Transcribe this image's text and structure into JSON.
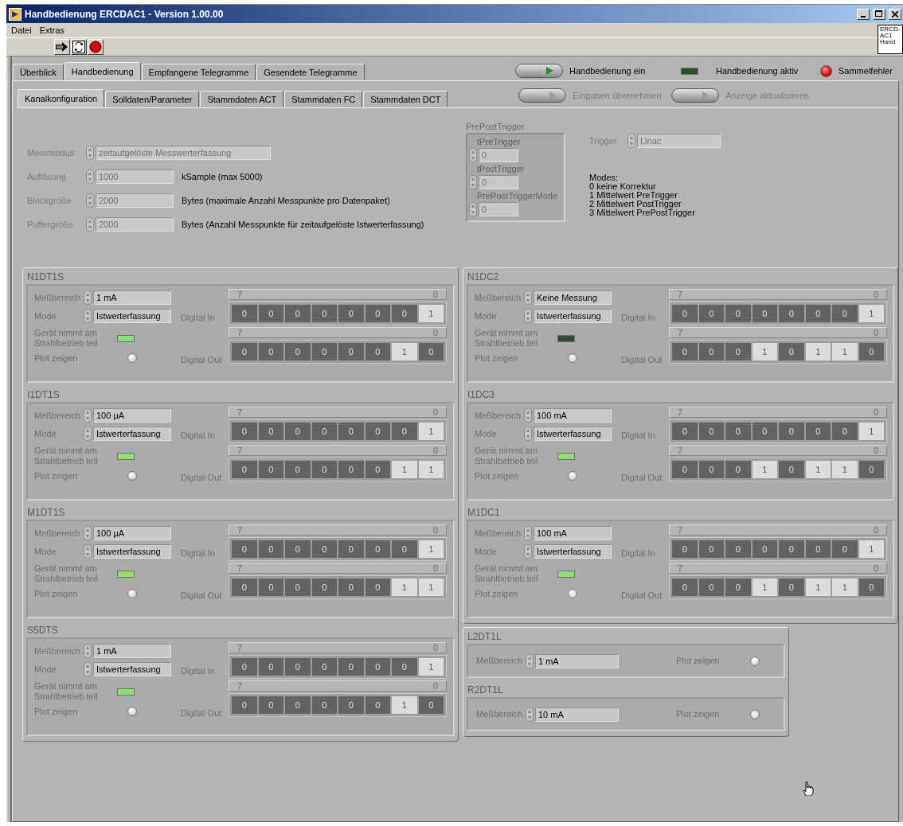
{
  "window": {
    "title": "Handbedienung ERCDAC1 - Version 1.00.00"
  },
  "menu": [
    "Datei",
    "Extras"
  ],
  "side_badge": [
    "ERCD-",
    "AC1",
    "Hand"
  ],
  "tabs": [
    {
      "label": "Überblick",
      "selected": false
    },
    {
      "label": "Handbedienung",
      "selected": true
    },
    {
      "label": "Empfangene Telegramme",
      "selected": false
    },
    {
      "label": "Gesendete Telegramme",
      "selected": false
    }
  ],
  "header_controls": [
    {
      "kind": "toggle",
      "label": "Handbedienung ein",
      "disabled": false
    },
    {
      "kind": "led",
      "label": "Handbedienung aktiv",
      "on": false
    },
    {
      "kind": "lamp",
      "label": "Sammelfehler",
      "on": true
    }
  ],
  "subtabs": [
    {
      "label": "Kanalkonfiguration",
      "selected": true
    },
    {
      "label": "Solldaten/Parameter",
      "selected": false
    },
    {
      "label": "Stammdaten ACT",
      "selected": false
    },
    {
      "label": "Stammdaten FC",
      "selected": false
    },
    {
      "label": "Stammdaten DCT",
      "selected": false
    }
  ],
  "subtab_controls": [
    {
      "label": "Eingaben übernehmen",
      "disabled": true
    },
    {
      "label": "Anzeige aktualisieren",
      "disabled": true
    }
  ],
  "config": {
    "fields": [
      {
        "label": "Messmodus",
        "value": "zeitaufgelöste Messwerterfassung",
        "disabled": true,
        "kind": "wide"
      },
      {
        "label": "Auflösung",
        "value": "1000",
        "unit": "kSample (max 5000)",
        "disabled": true,
        "kind": "narrow"
      },
      {
        "label": "Blockgröße",
        "value": "2000",
        "unit": "Bytes  (maximale Anzahl Messpunkte  pro Datenpaket)",
        "disabled": true,
        "kind": "narrow"
      },
      {
        "label": "Puffergröße",
        "value": "2000",
        "unit": "Bytes (Anzahl Messpunkte für zeitaufgelöste Istwerterfassung)",
        "disabled": true,
        "kind": "narrow"
      }
    ],
    "prepost": {
      "title": "PrePostTrigger",
      "fields": [
        {
          "label": "tPreTrigger",
          "value": "0",
          "disabled": true
        },
        {
          "label": "tPostTrigger",
          "value": "0",
          "disabled": true
        },
        {
          "label": "PrePostTriggerMode",
          "value": "0",
          "disabled": true
        }
      ]
    },
    "trigger": {
      "label": "Trigger",
      "value": "Linac",
      "disabled": true
    },
    "modes": [
      "Modes:",
      "0 keine Korrektur",
      "1 Mittelwert PreTrigger",
      "2 Mittelwert PostTrigger",
      "3 Mittelwert PrePostTrigger"
    ]
  },
  "left_channels": [
    {
      "name": "N1DT1S",
      "range_label": "Meßbereich",
      "range": "1 mA",
      "mode_label": "Mode",
      "mode": "Istwerterfassung",
      "led_label": "Gerät nimmt am Strahlbetrieb teil",
      "led_on": true,
      "plot_label": "Plot zeigen",
      "plot_on": false,
      "digital_in": {
        "label": "Digital In",
        "high": "7",
        "low": "0",
        "bits": [
          {
            "text": "0",
            "on": false
          },
          {
            "text": "0",
            "on": false
          },
          {
            "text": "0",
            "on": false
          },
          {
            "text": "0",
            "on": false
          },
          {
            "text": "0",
            "on": false
          },
          {
            "text": "0",
            "on": false
          },
          {
            "text": "0",
            "on": false
          },
          {
            "text": "1",
            "on": true
          }
        ]
      },
      "digital_out": {
        "label": "Digital Out",
        "high": "7",
        "low": "0",
        "bits": [
          {
            "text": "0",
            "on": false
          },
          {
            "text": "0",
            "on": false
          },
          {
            "text": "0",
            "on": false
          },
          {
            "text": "0",
            "on": false
          },
          {
            "text": "0",
            "on": false
          },
          {
            "text": "0",
            "on": false
          },
          {
            "text": "1",
            "on": true
          },
          {
            "text": "0",
            "on": false
          }
        ]
      }
    },
    {
      "name": "I1DT1S",
      "range_label": "Meßbereich",
      "range": "100 µA",
      "mode_label": "Mode",
      "mode": "Istwerterfassung",
      "led_label": "Gerät nimmt am Strahlbetrieb teil",
      "led_on": true,
      "plot_label": "Plot zeigen",
      "plot_on": false,
      "digital_in": {
        "label": "Digital In",
        "high": "7",
        "low": "0",
        "bits": [
          {
            "text": "0",
            "on": false
          },
          {
            "text": "0",
            "on": false
          },
          {
            "text": "0",
            "on": false
          },
          {
            "text": "0",
            "on": false
          },
          {
            "text": "0",
            "on": false
          },
          {
            "text": "0",
            "on": false
          },
          {
            "text": "0",
            "on": false
          },
          {
            "text": "1",
            "on": true
          }
        ]
      },
      "digital_out": {
        "label": "Digital Out",
        "high": "7",
        "low": "0",
        "bits": [
          {
            "text": "0",
            "on": false
          },
          {
            "text": "0",
            "on": false
          },
          {
            "text": "0",
            "on": false
          },
          {
            "text": "0",
            "on": false
          },
          {
            "text": "0",
            "on": false
          },
          {
            "text": "0",
            "on": false
          },
          {
            "text": "1",
            "on": true
          },
          {
            "text": "1",
            "on": true
          }
        ]
      }
    },
    {
      "name": "M1DT1S",
      "range_label": "Meßbereich",
      "range": "100 µA",
      "mode_label": "Mode",
      "mode": "Istwerterfassung",
      "led_label": "Gerät nimmt am Strahlbetrieb teil",
      "led_on": true,
      "plot_label": "Plot zeigen",
      "plot_on": false,
      "digital_in": {
        "label": "Digital In",
        "high": "7",
        "low": "0",
        "bits": [
          {
            "text": "0",
            "on": false
          },
          {
            "text": "0",
            "on": false
          },
          {
            "text": "0",
            "on": false
          },
          {
            "text": "0",
            "on": false
          },
          {
            "text": "0",
            "on": false
          },
          {
            "text": "0",
            "on": false
          },
          {
            "text": "0",
            "on": false
          },
          {
            "text": "1",
            "on": true
          }
        ]
      },
      "digital_out": {
        "label": "Digital Out",
        "high": "7",
        "low": "0",
        "bits": [
          {
            "text": "0",
            "on": false
          },
          {
            "text": "0",
            "on": false
          },
          {
            "text": "0",
            "on": false
          },
          {
            "text": "0",
            "on": false
          },
          {
            "text": "0",
            "on": false
          },
          {
            "text": "0",
            "on": false
          },
          {
            "text": "1",
            "on": true
          },
          {
            "text": "1",
            "on": true
          }
        ]
      }
    },
    {
      "name": "S5DTS",
      "range_label": "Meßbereich",
      "range": "1 mA",
      "mode_label": "Mode",
      "mode": "Istwerterfassung",
      "led_label": "Gerät nimmt am Strahlbetrieb teil",
      "led_on": true,
      "plot_label": "Plot zeigen",
      "plot_on": false,
      "digital_in": {
        "label": "Digital In",
        "high": "7",
        "low": "0",
        "bits": [
          {
            "text": "0",
            "on": false
          },
          {
            "text": "0",
            "on": false
          },
          {
            "text": "0",
            "on": false
          },
          {
            "text": "0",
            "on": false
          },
          {
            "text": "0",
            "on": false
          },
          {
            "text": "0",
            "on": false
          },
          {
            "text": "0",
            "on": false
          },
          {
            "text": "1",
            "on": true
          }
        ]
      },
      "digital_out": {
        "label": "Digital Out",
        "high": "7",
        "low": "0",
        "bits": [
          {
            "text": "0",
            "on": false
          },
          {
            "text": "0",
            "on": false
          },
          {
            "text": "0",
            "on": false
          },
          {
            "text": "0",
            "on": false
          },
          {
            "text": "0",
            "on": false
          },
          {
            "text": "0",
            "on": false
          },
          {
            "text": "1",
            "on": true
          },
          {
            "text": "0",
            "on": false
          }
        ]
      }
    }
  ],
  "right_channels": [
    {
      "name": "N1DC2",
      "range_label": "Meßbereich",
      "range": "Keine Messung",
      "mode_label": "Mode",
      "mode": "Istwerterfassung",
      "led_label": "Gerät nimmt am Strahlbetrieb teil",
      "led_on": false,
      "plot_label": "Plot zeigen",
      "plot_on": false,
      "digital_in": {
        "label": "Digital In",
        "high": "7",
        "low": "0",
        "bits": [
          {
            "text": "0",
            "on": false
          },
          {
            "text": "0",
            "on": false
          },
          {
            "text": "0",
            "on": false
          },
          {
            "text": "0",
            "on": false
          },
          {
            "text": "0",
            "on": false
          },
          {
            "text": "0",
            "on": false
          },
          {
            "text": "0",
            "on": false
          },
          {
            "text": "1",
            "on": true
          }
        ]
      },
      "digital_out": {
        "label": "Digital Out",
        "high": "7",
        "low": "0",
        "bits": [
          {
            "text": "0",
            "on": false
          },
          {
            "text": "0",
            "on": false
          },
          {
            "text": "0",
            "on": false
          },
          {
            "text": "1",
            "on": true
          },
          {
            "text": "0",
            "on": false
          },
          {
            "text": "1",
            "on": true
          },
          {
            "text": "1",
            "on": true
          },
          {
            "text": "0",
            "on": false
          }
        ]
      }
    },
    {
      "name": "I1DC3",
      "range_label": "Meßbereich",
      "range": "100 mA",
      "mode_label": "Mode",
      "mode": "Istwerterfassung",
      "led_label": "Gerät nimmt am Strahlbetrieb teil",
      "led_on": true,
      "plot_label": "Plot zeigen",
      "plot_on": false,
      "digital_in": {
        "label": "Digital In",
        "high": "7",
        "low": "0",
        "bits": [
          {
            "text": "0",
            "on": false
          },
          {
            "text": "0",
            "on": false
          },
          {
            "text": "0",
            "on": false
          },
          {
            "text": "0",
            "on": false
          },
          {
            "text": "0",
            "on": false
          },
          {
            "text": "0",
            "on": false
          },
          {
            "text": "0",
            "on": false
          },
          {
            "text": "1",
            "on": true
          }
        ]
      },
      "digital_out": {
        "label": "Digital Out",
        "high": "7",
        "low": "0",
        "bits": [
          {
            "text": "0",
            "on": false
          },
          {
            "text": "0",
            "on": false
          },
          {
            "text": "0",
            "on": false
          },
          {
            "text": "1",
            "on": true
          },
          {
            "text": "0",
            "on": false
          },
          {
            "text": "1",
            "on": true
          },
          {
            "text": "1",
            "on": true
          },
          {
            "text": "0",
            "on": false
          }
        ]
      }
    },
    {
      "name": "M1DC1",
      "range_label": "Meßbereich",
      "range": "100 mA",
      "mode_label": "Mode",
      "mode": "Istwerterfassung",
      "led_label": "Gerät nimmt am Strahlbetrieb teil",
      "led_on": true,
      "plot_label": "Plot zeigen",
      "plot_on": false,
      "digital_in": {
        "label": "Digital In",
        "high": "7",
        "low": "0",
        "bits": [
          {
            "text": "0",
            "on": false
          },
          {
            "text": "0",
            "on": false
          },
          {
            "text": "0",
            "on": false
          },
          {
            "text": "0",
            "on": false
          },
          {
            "text": "0",
            "on": false
          },
          {
            "text": "0",
            "on": false
          },
          {
            "text": "0",
            "on": false
          },
          {
            "text": "1",
            "on": true
          }
        ]
      },
      "digital_out": {
        "label": "Digital Out",
        "high": "7",
        "low": "0",
        "bits": [
          {
            "text": "0",
            "on": false
          },
          {
            "text": "0",
            "on": false
          },
          {
            "text": "0",
            "on": false
          },
          {
            "text": "1",
            "on": true
          },
          {
            "text": "0",
            "on": false
          },
          {
            "text": "1",
            "on": true
          },
          {
            "text": "1",
            "on": true
          },
          {
            "text": "0",
            "on": false
          }
        ]
      }
    }
  ],
  "simple_channels": [
    {
      "name": "L2DT1L",
      "range_label": "Meßbereich",
      "range": "1 mA",
      "plot_label": "Plot zeigen",
      "plot_on": false
    },
    {
      "name": "R2DT1L",
      "range_label": "Meßbereich",
      "range": "10 mA",
      "plot_label": "Plot zeigen",
      "plot_on": false
    }
  ]
}
